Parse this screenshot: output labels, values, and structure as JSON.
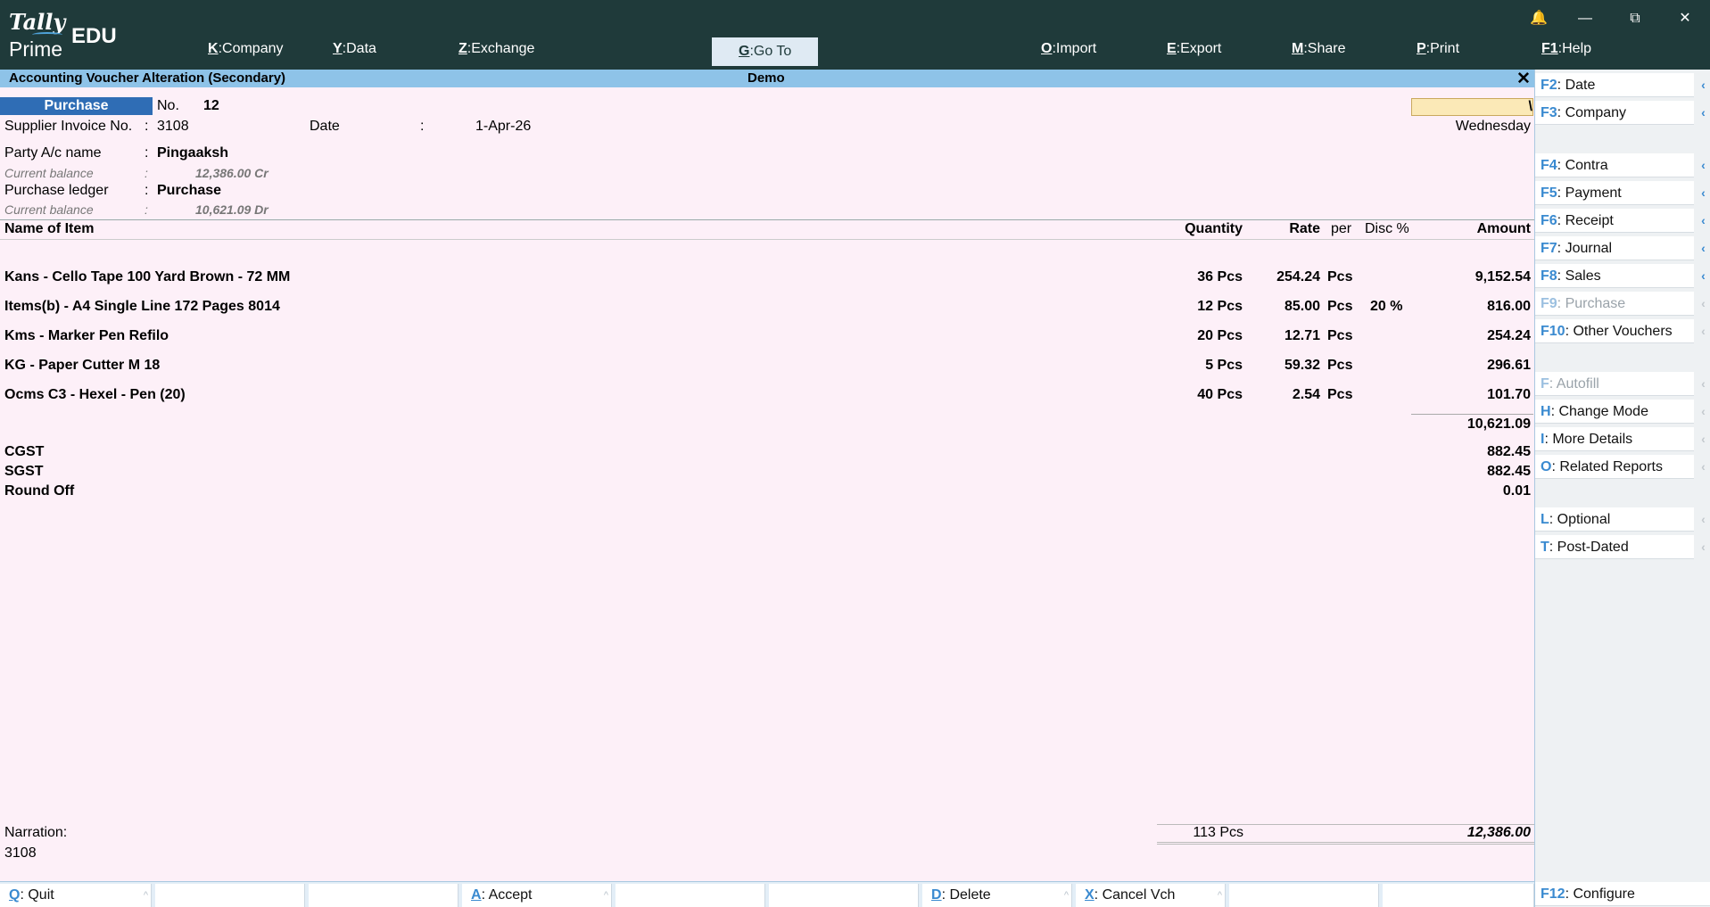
{
  "app": {
    "logo_tally": "Tally",
    "logo_prime": "Prime",
    "logo_edu": "EDU"
  },
  "window_controls": {
    "bell": "🔔",
    "minimize": "—",
    "restore": "⧉",
    "close": "✕"
  },
  "top_menu": [
    {
      "key": "K",
      "label": "Company"
    },
    {
      "key": "Y",
      "label": "Data"
    },
    {
      "key": "Z",
      "label": "Exchange"
    },
    {
      "key": "G",
      "label": "Go To"
    },
    {
      "key": "O",
      "label": "Import"
    },
    {
      "key": "E",
      "label": "Export"
    },
    {
      "key": "M",
      "label": "Share"
    },
    {
      "key": "P",
      "label": "Print"
    },
    {
      "key": "F1",
      "label": "Help"
    }
  ],
  "titlebar": {
    "title": "Accounting Voucher Alteration (Secondary)",
    "company": "Demo",
    "close": "✕"
  },
  "voucher": {
    "type": "Purchase",
    "no_label": "No.",
    "no_value": "12",
    "date_input": "\\",
    "day": "Wednesday",
    "supplier_invoice_label": "Supplier Invoice No.",
    "supplier_invoice_value": "3108",
    "date_label": "Date",
    "date_value": "1-Apr-26",
    "colon": ":",
    "party_label": "Party A/c name",
    "party_value": "Pingaaksh",
    "party_balance_label": "Current balance",
    "party_balance_value": "12,386.00 Cr",
    "ledger_label": "Purchase ledger",
    "ledger_value": "Purchase",
    "ledger_balance_label": "Current balance",
    "ledger_balance_value": "10,621.09 Dr"
  },
  "table": {
    "headers": {
      "name": "Name of Item",
      "quantity": "Quantity",
      "rate": "Rate",
      "per": "per",
      "disc": "Disc %",
      "amount": "Amount"
    },
    "rows": [
      {
        "name": "Kans - Cello Tape 100 Yard Brown - 72 MM",
        "qty": "36 Pcs",
        "rate": "254.24",
        "per": "Pcs",
        "disc": "",
        "amount": "9,152.54"
      },
      {
        "name": "Items(b) - A4 Single Line 172 Pages 8014",
        "qty": "12 Pcs",
        "rate": "85.00",
        "per": "Pcs",
        "disc": "20 %",
        "amount": "816.00"
      },
      {
        "name": "Kms - Marker Pen Refilo",
        "qty": "20 Pcs",
        "rate": "12.71",
        "per": "Pcs",
        "disc": "",
        "amount": "254.24"
      },
      {
        "name": "KG - Paper Cutter M 18",
        "qty": "5 Pcs",
        "rate": "59.32",
        "per": "Pcs",
        "disc": "",
        "amount": "296.61"
      },
      {
        "name": "Ocms C3 - Hexel - Pen (20)",
        "qty": "40 Pcs",
        "rate": "2.54",
        "per": "Pcs",
        "disc": "",
        "amount": "101.70"
      }
    ],
    "subtotal": "10,621.09",
    "taxes": [
      {
        "name": "CGST",
        "amount": "882.45"
      },
      {
        "name": "SGST",
        "amount": "882.45"
      },
      {
        "name": "Round Off",
        "amount": "0.01"
      }
    ]
  },
  "footer": {
    "narration_label": "Narration:",
    "narration_value": "3108",
    "total_qty": "113 Pcs",
    "total_amount": "12,386.00"
  },
  "right_panel": [
    {
      "key": "F2",
      "label": "Date",
      "enabled": true
    },
    {
      "key": "F3",
      "label": "Company",
      "enabled": true
    },
    {
      "key": "F4",
      "label": "Contra",
      "enabled": true
    },
    {
      "key": "F5",
      "label": "Payment",
      "enabled": true
    },
    {
      "key": "F6",
      "label": "Receipt",
      "enabled": true
    },
    {
      "key": "F7",
      "label": "Journal",
      "enabled": true
    },
    {
      "key": "F8",
      "label": "Sales",
      "enabled": true
    },
    {
      "key": "F9",
      "label": "Purchase",
      "enabled": false
    },
    {
      "key": "F10",
      "label": "Other Vouchers",
      "enabled": true
    },
    {
      "key": "F",
      "label": "Autofill",
      "enabled": false
    },
    {
      "key": "H",
      "label": "Change Mode",
      "enabled": true
    },
    {
      "key": "I",
      "label": "More Details",
      "enabled": true
    },
    {
      "key": "O",
      "label": "Related Reports",
      "enabled": true
    },
    {
      "key": "L",
      "label": "Optional",
      "enabled": true
    },
    {
      "key": "T",
      "label": "Post-Dated",
      "enabled": true
    },
    {
      "key": "F12",
      "label": "Configure",
      "enabled": true
    }
  ],
  "bottom_bar": [
    {
      "key": "Q",
      "label": "Quit"
    },
    {
      "key": "A",
      "label": "Accept"
    },
    {
      "key": "D",
      "label": "Delete"
    },
    {
      "key": "X",
      "label": "Cancel Vch"
    }
  ],
  "chevron": "‹",
  "up_chevron": "^"
}
